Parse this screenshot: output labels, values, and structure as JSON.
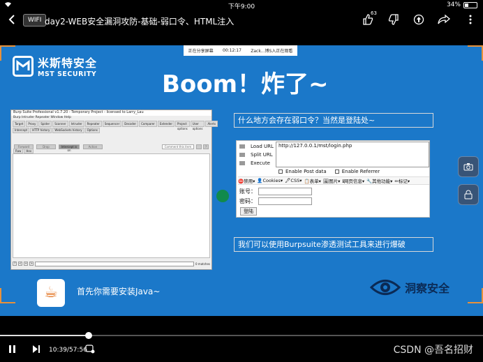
{
  "status_bar": {
    "time": "下午9:00",
    "battery": "34%"
  },
  "nav": {
    "badge": "WIFI",
    "title": "day2-WEB安全漏洞攻防-基础-弱口令、HTML注入",
    "like_count": "63"
  },
  "slide": {
    "brand_cn": "米斯特安全",
    "brand_en": "MST SECURITY",
    "sharing_bar": {
      "left": "正在分享屏幕",
      "middle": "00:12:17",
      "right": "Zack...博S入正在观看"
    },
    "heading": "Boom！炸了~",
    "question_box": "什么地方会存在弱口令？当然是登陆处~",
    "burp_box": "我们可以使用Burpsuite渗透测试工具来进行爆破",
    "java_text": "首先你需要安装Java~",
    "footer_brand": "洞察安全",
    "colors": {
      "slide_bg": "#1b78c9",
      "corner_accent": "#e8913a"
    }
  },
  "burp": {
    "title": "Burp Suite Professional v1.7.20 - Temporary Project - licensed to Larry_Lau",
    "menu": "Burp  Intruder  Repeater  Window  Help",
    "tabs": [
      "Target",
      "Proxy",
      "Spider",
      "Scanner",
      "Intruder",
      "Repeater",
      "Sequencer",
      "Decoder",
      "Comparer",
      "Extender",
      "Project options",
      "User options",
      "Alerts"
    ],
    "subtabs": [
      "Intercept",
      "HTTP history",
      "WebSockets history",
      "Options"
    ],
    "buttons": {
      "forward": "Forward",
      "drop": "Drop",
      "intercept": "Intercept is on",
      "action": "Action",
      "comment": "Comment this item"
    },
    "raw_tabs": [
      "Raw",
      "Hex"
    ],
    "footer": {
      "prev": "<",
      "plus": "+",
      "next": ">",
      "matches": "0 matches",
      "help": "?"
    }
  },
  "hackbar": {
    "load_url": "Load URL",
    "split_url": "Split URL",
    "execute": "Execute",
    "url_value": "http://127.0.0.1/mst/login.php",
    "enable_post": "Enable Post data",
    "enable_referrer": "Enable Referrer",
    "toolbar": [
      "⛔禁用▾",
      "👤Cookies▾",
      "🖋CSS▾",
      "📋表单▾",
      "🖼图片▾",
      "ℹ网页信息▾",
      "🔧其他功能▾",
      "✏标记▾"
    ],
    "account_label": "账号：",
    "password_label": "密码：",
    "login_button": "登陆"
  },
  "player": {
    "current_time": "10:39",
    "duration": "57:56",
    "progress": 0.184,
    "watermark": "CSDN @吾名招财"
  }
}
